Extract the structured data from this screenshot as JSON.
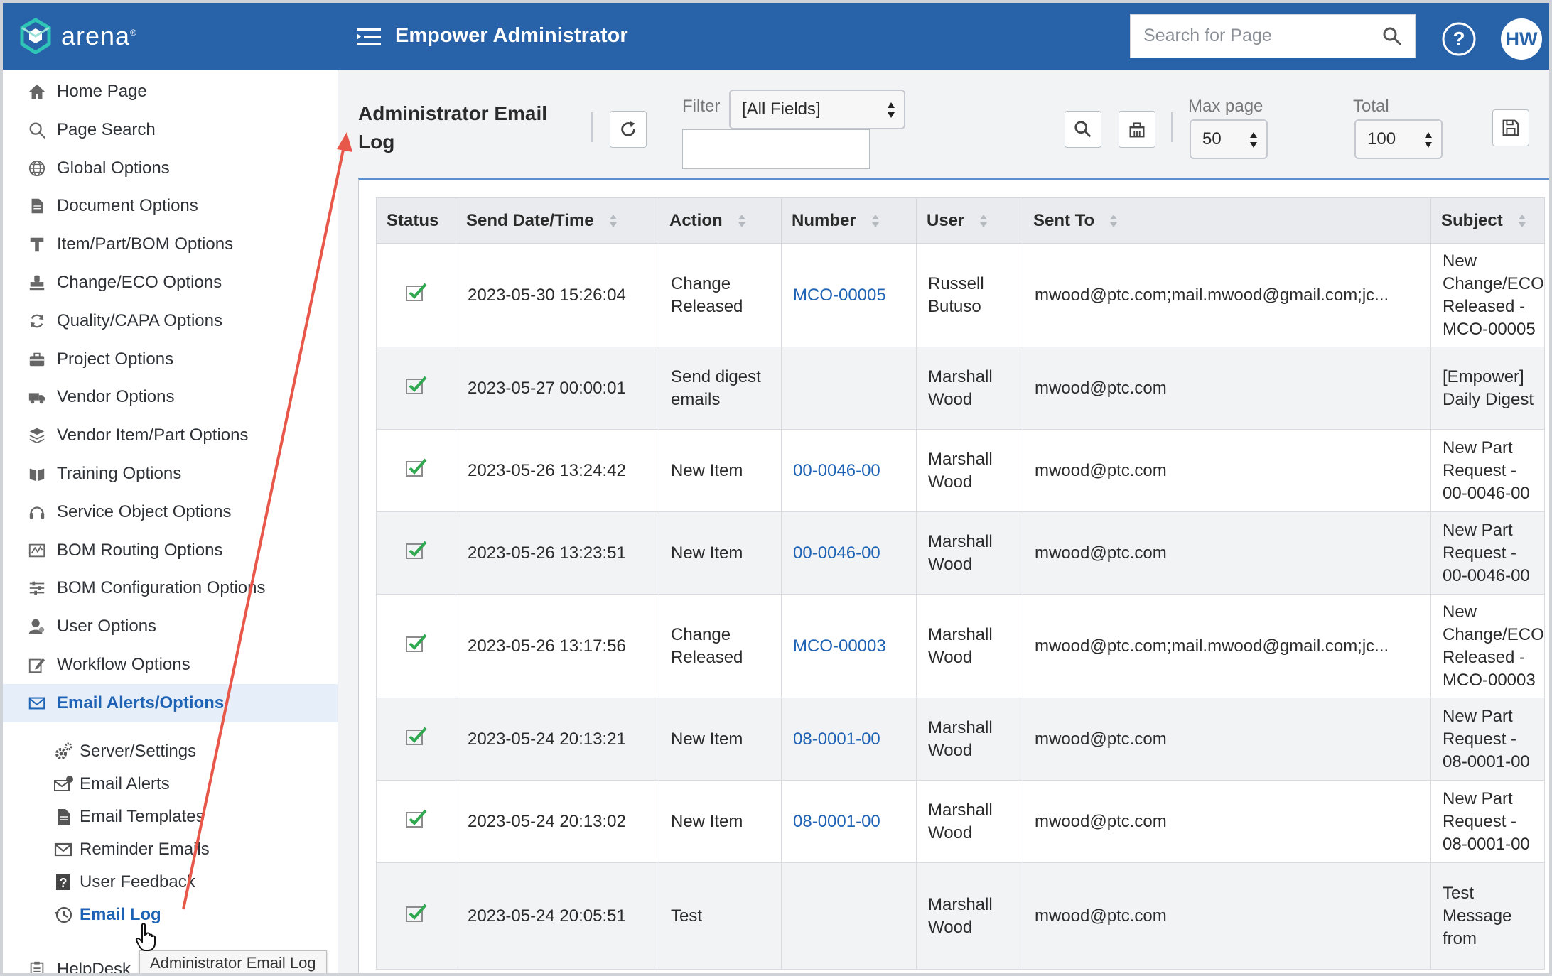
{
  "header": {
    "logo_text": "arena",
    "logo_reg": "®",
    "app_title": "Empower Administrator",
    "search_placeholder": "Search for Page",
    "avatar_initials": "HW"
  },
  "sidebar": {
    "items": [
      {
        "label": "Home Page",
        "icon": "home-icon"
      },
      {
        "label": "Page Search",
        "icon": "search-icon"
      },
      {
        "label": "Global Options",
        "icon": "globe-icon"
      },
      {
        "label": "Document Options",
        "icon": "document-icon"
      },
      {
        "label": "Item/Part/BOM Options",
        "icon": "part-icon"
      },
      {
        "label": "Change/ECO Options",
        "icon": "stamp-icon"
      },
      {
        "label": "Quality/CAPA Options",
        "icon": "cycle-icon"
      },
      {
        "label": "Project Options",
        "icon": "briefcase-icon"
      },
      {
        "label": "Vendor Options",
        "icon": "truck-icon"
      },
      {
        "label": "Vendor Item/Part Options",
        "icon": "layers-icon"
      },
      {
        "label": "Training Options",
        "icon": "book-icon"
      },
      {
        "label": "Service Object Options",
        "icon": "headset-icon"
      },
      {
        "label": "BOM Routing Options",
        "icon": "routing-icon"
      },
      {
        "label": "BOM Configuration Options",
        "icon": "sliders-icon"
      },
      {
        "label": "User Options",
        "icon": "user-icon"
      },
      {
        "label": "Workflow Options",
        "icon": "edit-icon"
      },
      {
        "label": "Email Alerts/Options",
        "icon": "envelope-icon"
      }
    ],
    "sub_items": [
      {
        "label": "Server/Settings",
        "icon": "gears-icon"
      },
      {
        "label": "Email Alerts",
        "icon": "email-alert-icon"
      },
      {
        "label": "Email Templates",
        "icon": "template-icon"
      },
      {
        "label": "Reminder Emails",
        "icon": "envelope-icon"
      },
      {
        "label": "User Feedback",
        "icon": "question-icon"
      },
      {
        "label": "Email Log",
        "icon": "history-icon"
      }
    ],
    "partial_item": {
      "label": "HelpDesk",
      "icon": "clipboard-icon"
    },
    "tooltip": "Administrator Email Log"
  },
  "toolbar": {
    "title": "Administrator Email Log",
    "filter_label": "Filter",
    "filter_value": "[All Fields]",
    "filter_text": "",
    "max_page_label": "Max page",
    "max_page_value": "50",
    "total_label": "Total",
    "total_value": "100"
  },
  "table": {
    "columns": [
      "Status",
      "Send Date/Time",
      "Action",
      "Number",
      "User",
      "Sent To",
      "Subject"
    ],
    "rows": [
      {
        "status": "sent",
        "date": "2023-05-30 15:26:04",
        "action": "Change Released",
        "number": "MCO-00005",
        "user": "Russell Butuso",
        "sent_to": "mwood@ptc.com;mail.mwood@gmail.com;jc...",
        "subject": "New Change/ECO Released - MCO-00005"
      },
      {
        "status": "sent",
        "date": "2023-05-27 00:00:01",
        "action": "Send digest emails",
        "number": "",
        "user": "Marshall Wood",
        "sent_to": "mwood@ptc.com",
        "subject": "[Empower] Daily Digest"
      },
      {
        "status": "sent",
        "date": "2023-05-26 13:24:42",
        "action": "New Item",
        "number": "00-0046-00",
        "user": "Marshall Wood",
        "sent_to": "mwood@ptc.com",
        "subject": "New Part Request - 00-0046-00"
      },
      {
        "status": "sent",
        "date": "2023-05-26 13:23:51",
        "action": "New Item",
        "number": "00-0046-00",
        "user": "Marshall Wood",
        "sent_to": "mwood@ptc.com",
        "subject": "New Part Request - 00-0046-00"
      },
      {
        "status": "sent",
        "date": "2023-05-26 13:17:56",
        "action": "Change Released",
        "number": "MCO-00003",
        "user": "Marshall Wood",
        "sent_to": "mwood@ptc.com;mail.mwood@gmail.com;jc...",
        "subject": "New Change/ECO Released - MCO-00003"
      },
      {
        "status": "sent",
        "date": "2023-05-24 20:13:21",
        "action": "New Item",
        "number": "08-0001-00",
        "user": "Marshall Wood",
        "sent_to": "mwood@ptc.com",
        "subject": "New Part Request - 08-0001-00"
      },
      {
        "status": "sent",
        "date": "2023-05-24 20:13:02",
        "action": "New Item",
        "number": "08-0001-00",
        "user": "Marshall Wood",
        "sent_to": "mwood@ptc.com",
        "subject": "New Part Request - 08-0001-00"
      },
      {
        "status": "sent",
        "date": "2023-05-24 20:05:51",
        "action": "Test",
        "number": "",
        "user": "Marshall Wood",
        "sent_to": "mwood@ptc.com",
        "subject": "Test Message from"
      }
    ]
  },
  "colors": {
    "header_bg": "#2862a8",
    "link": "#1f63b5",
    "status_green": "#2fa84f",
    "annotation_arrow": "#e8584a"
  }
}
